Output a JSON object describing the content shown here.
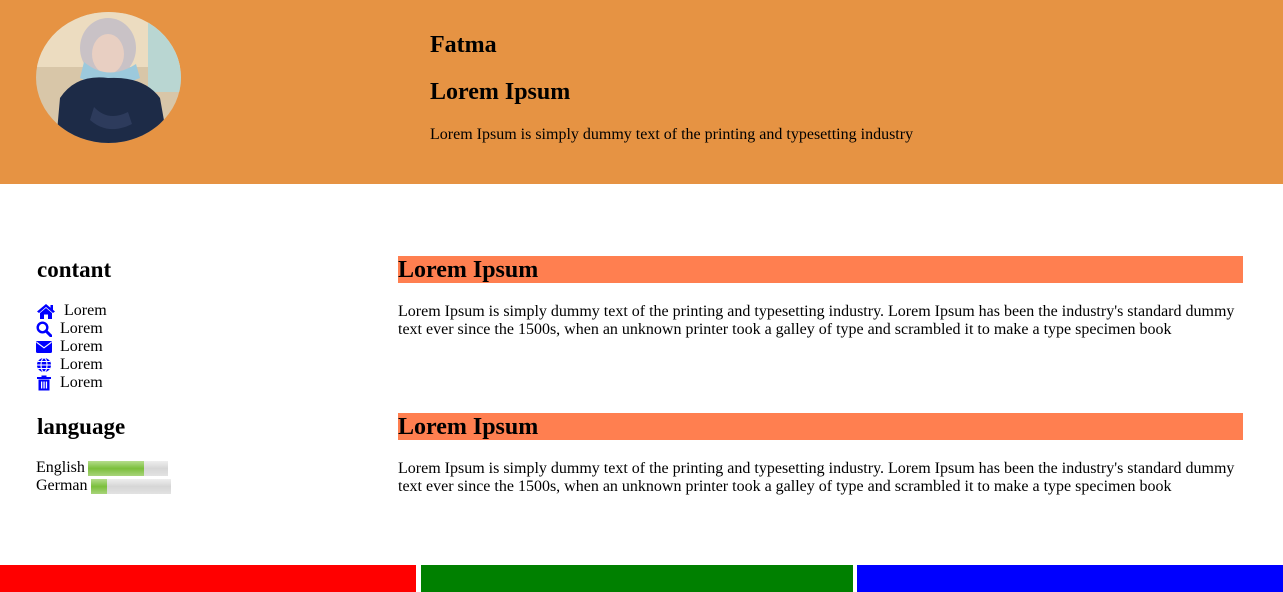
{
  "colors": {
    "header_bg": "#E69343",
    "section_title_bg": "#FF7F50",
    "icon": "#0000FF",
    "footer": [
      "#FF0000",
      "#008000",
      "#0000FF"
    ]
  },
  "header": {
    "name": "Fatma",
    "subtitle": "Lorem Ipsum",
    "tagline": "Lorem Ipsum is simply dummy text of the printing and typesetting industry"
  },
  "sidebar": {
    "contact_heading": "contant",
    "contact_items": [
      {
        "icon": "home-icon",
        "label": "Lorem"
      },
      {
        "icon": "search-icon",
        "label": "Lorem"
      },
      {
        "icon": "envelope-icon",
        "label": "Lorem"
      },
      {
        "icon": "globe-icon",
        "label": "Lorem"
      },
      {
        "icon": "trash-icon",
        "label": "Lorem"
      }
    ],
    "language_heading": "language",
    "languages": [
      {
        "name": "English",
        "level": 0.7
      },
      {
        "name": "German",
        "level": 0.2
      }
    ]
  },
  "main": {
    "sections": [
      {
        "title": "Lorem Ipsum",
        "body": "Lorem Ipsum is simply dummy text of the printing and typesetting industry. Lorem Ipsum has been the industry's standard dummy text ever since the 1500s, when an unknown printer took a galley of type and scrambled it to make a type specimen book"
      },
      {
        "title": "Lorem Ipsum",
        "body": "Lorem Ipsum is simply dummy text of the printing and typesetting industry. Lorem Ipsum has been the industry's standard dummy text ever since the 1500s, when an unknown printer took a galley of type and scrambled it to make a type specimen book"
      }
    ]
  }
}
